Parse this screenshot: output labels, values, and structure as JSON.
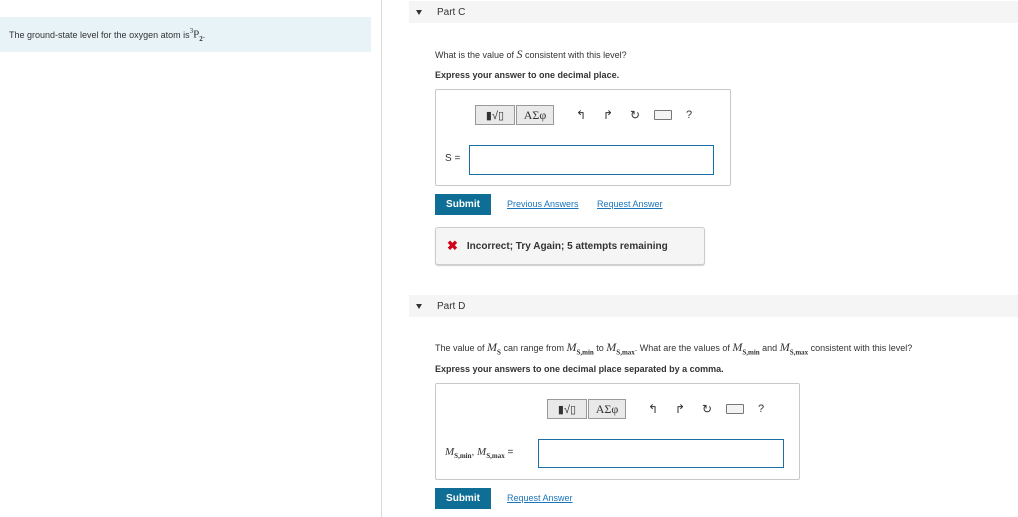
{
  "problem": {
    "text": "The ground-state level for the oxygen atom is ",
    "term_super": "3",
    "term_letter": "P",
    "term_sub": "2",
    "term_end": "."
  },
  "partC": {
    "title": "Part C",
    "question_pre": "What is the value of ",
    "question_var": "S",
    "question_post": " consistent with this level?",
    "instruction": "Express your answer to one decimal place.",
    "toolbar_templates": "▮√▯",
    "toolbar_greek": "ΑΣφ",
    "help": "?",
    "var_label": "S =",
    "input_value": "",
    "submit": "Submit",
    "previous_answers": "Previous Answers",
    "request_answer": "Request Answer",
    "feedback": "Incorrect; Try Again; 5 attempts remaining",
    "feedback_icon": "✖"
  },
  "partD": {
    "title": "Part D",
    "q1": "The value of ",
    "ms": "M",
    "ms_sub": "S",
    "q2": " can range from ",
    "msmin_sub": "S,min",
    "q3": " to ",
    "msmax_sub": "S,max",
    "q4": ". What are the values of ",
    "q5": " and ",
    "q6": " consistent with this level?",
    "instruction": "Express your answers to one decimal place separated by a comma.",
    "toolbar_templates": "▮√▯",
    "toolbar_greek": "ΑΣφ",
    "help": "?",
    "label_sep": ", ",
    "label_eq": " =",
    "input_value": "",
    "submit": "Submit",
    "request_answer": "Request Answer"
  }
}
